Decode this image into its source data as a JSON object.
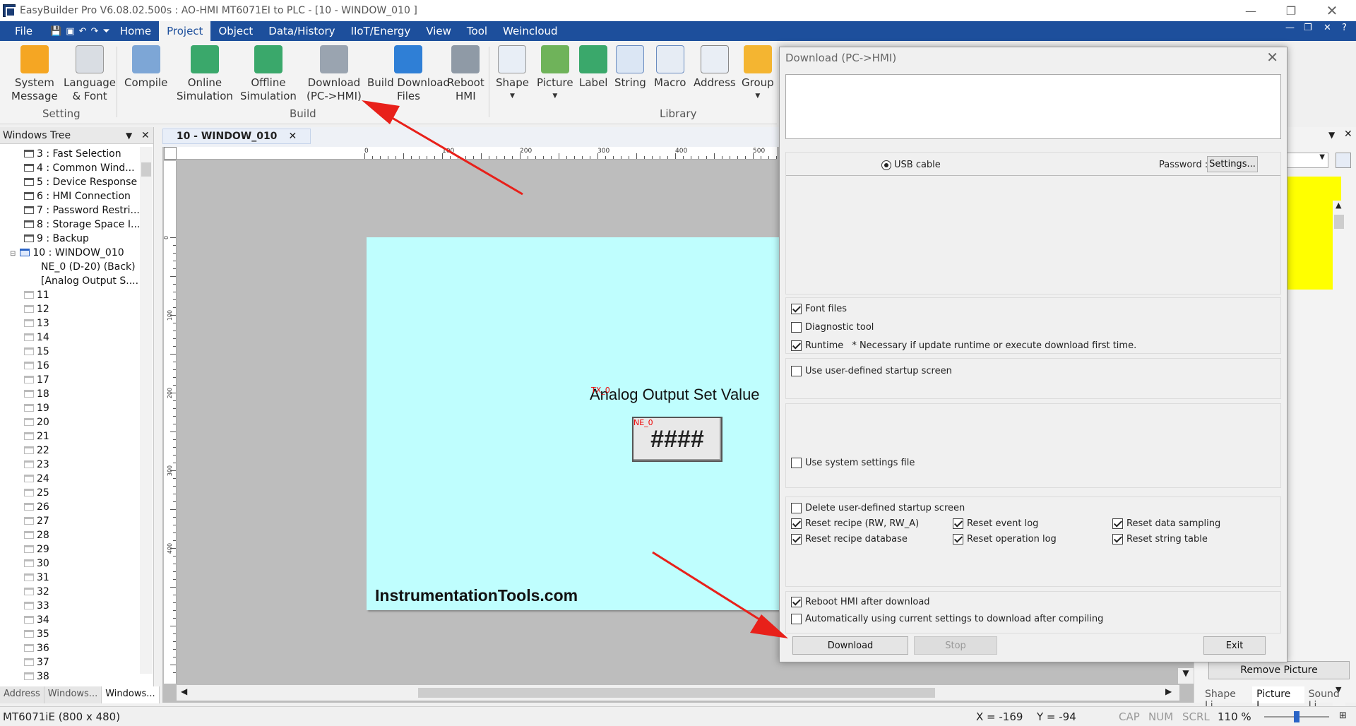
{
  "titlebar": {
    "title": "EasyBuilder Pro V6.08.02.500s : AO-HMI MT6071EI to PLC - [10 - WINDOW_010 ]"
  },
  "menubar": {
    "items": [
      "File",
      "Home",
      "Project",
      "Object",
      "Data/History",
      "IIoT/Energy",
      "View",
      "Tool",
      "Weincloud"
    ],
    "active": "Project"
  },
  "ribbon": {
    "setting": {
      "label": "Setting",
      "system_message": [
        "System",
        "Message"
      ],
      "language_font": [
        "Language",
        "& Font"
      ]
    },
    "build": {
      "label": "Build",
      "compile": "Compile",
      "online_sim": [
        "Online",
        "Simulation"
      ],
      "offline_sim": [
        "Offline",
        "Simulation"
      ],
      "download": [
        "Download",
        "(PC->HMI)"
      ],
      "build_download": [
        "Build Download",
        "Files"
      ],
      "reboot": [
        "Reboot",
        "HMI"
      ]
    },
    "library": {
      "label": "Library",
      "shape": "Shape",
      "picture": "Picture",
      "label_btn": "Label",
      "string": "String",
      "macro": "Macro",
      "address": "Address",
      "group": "Group"
    }
  },
  "windows_tree": {
    "title": "Windows Tree",
    "items": [
      "3 : Fast Selection",
      "4 : Common Wind...",
      "5 : Device Response",
      "6 : HMI Connection",
      "7 : Password Restri...",
      "8 : Storage Space I...",
      "9 : Backup",
      "10 : WINDOW_010"
    ],
    "children": [
      "NE_0 (D-20) (Back)",
      "[Analog Output S...."
    ],
    "empty": [
      "11",
      "12",
      "13",
      "14",
      "15",
      "16",
      "17",
      "18",
      "19",
      "20",
      "21",
      "22",
      "23",
      "24",
      "25",
      "26",
      "27",
      "28",
      "29",
      "30",
      "31",
      "32",
      "33",
      "34",
      "35",
      "36",
      "37",
      "38"
    ],
    "bottom_tabs": [
      "Address",
      "Windows...",
      "Windows..."
    ]
  },
  "editor": {
    "tab_label": "10 - WINDOW_010",
    "ruler_top": [
      "0",
      "100",
      "200",
      "300",
      "400",
      "500"
    ],
    "ruler_left": [
      "0",
      "100",
      "200",
      "300",
      "400"
    ],
    "label_text": "Analog Output Set Value",
    "label_tag": "TX_0",
    "numeric_display": "####",
    "numeric_tag": "NE_0",
    "watermark": "InstrumentationTools.com"
  },
  "right_pane": {
    "remove_picture": "Remove Picture",
    "bottom_tabs": [
      "Shape Li...",
      "Picture L...",
      "Sound Li..."
    ]
  },
  "statusbar": {
    "model": "MT6071iE (800 x 480)",
    "x": "X = -169",
    "y": "Y = -94",
    "cap": "CAP",
    "num": "NUM",
    "scrl": "SCRL",
    "zoom": "110 %"
  },
  "dialog": {
    "title": "Download (PC->HMI)",
    "usb_cable": "USB cable",
    "password_label": "Password :",
    "settings_btn": "Settings...",
    "font_files": "Font files",
    "diagnostic_tool": "Diagnostic tool",
    "runtime": "Runtime",
    "runtime_note": "* Necessary if update runtime or execute download first time.",
    "user_startup": "Use user-defined startup screen",
    "system_settings": "Use system settings file",
    "delete_startup": "Delete user-defined startup screen",
    "reset_recipe": "Reset recipe (RW, RW_A)",
    "reset_event": "Reset event log",
    "reset_sampling": "Reset data sampling",
    "reset_recipe_db": "Reset recipe database",
    "reset_operation": "Reset operation log",
    "reset_string": "Reset string table",
    "reboot_after": "Reboot HMI after download",
    "auto_download": "Automatically using current settings to download after compiling",
    "download_btn": "Download",
    "stop_btn": "Stop",
    "exit_btn": "Exit"
  },
  "colors": {
    "menubar": "#1d4f9c",
    "canvas": "#bffefe",
    "arrow": "#e8201a"
  }
}
